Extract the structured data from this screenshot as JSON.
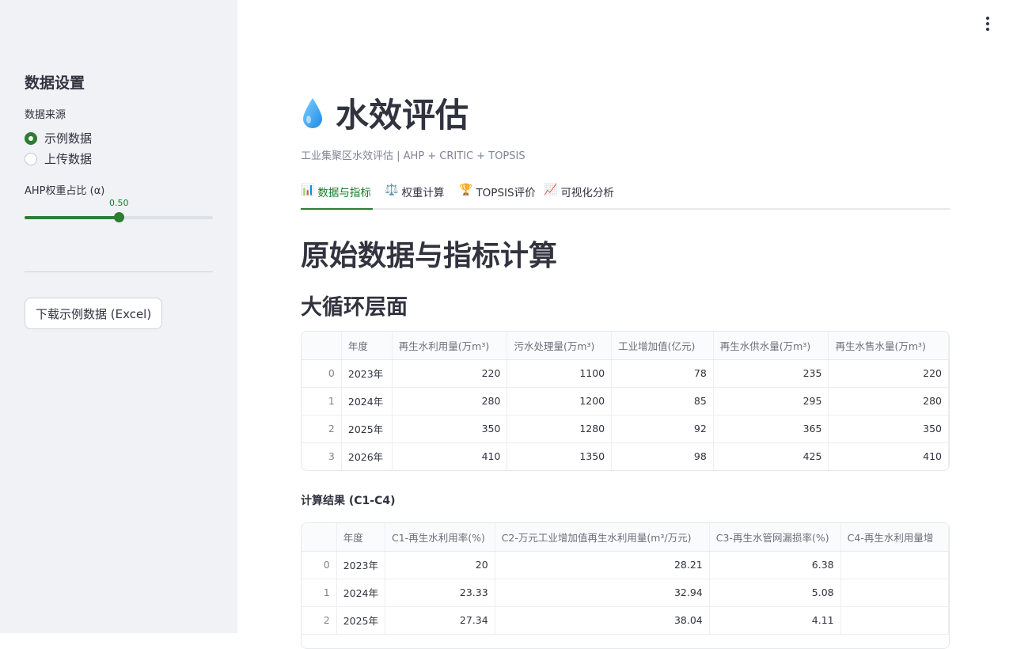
{
  "sidebar": {
    "title": "数据设置",
    "source_label": "数据来源",
    "source_options": [
      "示例数据",
      "上传数据"
    ],
    "selected_source": "示例数据",
    "weight_label": "AHP权重占比 (α)",
    "weight_value": "0.50",
    "weight_fraction": 0.5,
    "download_button": "下载示例数据 (Excel)"
  },
  "header": {
    "title": "水效评估",
    "icon": "droplet-icon",
    "caption": "工业集聚区水效评估 | AHP + CRITIC + TOPSIS"
  },
  "tabs": [
    {
      "icon": "📊",
      "label": "数据与指标",
      "active": true
    },
    {
      "icon": "⚖️",
      "label": "权重计算",
      "active": false
    },
    {
      "icon": "🏆",
      "label": "TOPSIS评价",
      "active": false
    },
    {
      "icon": "📈",
      "label": "可视化分析",
      "active": false
    }
  ],
  "section_title": "原始数据与指标计算",
  "subsection_title": "大循环层面",
  "table1": {
    "columns": [
      "",
      "年度",
      "再生水利用量(万m³)",
      "污水处理量(万m³)",
      "工业增加值(亿元)",
      "再生水供水量(万m³)",
      "再生水售水量(万m³)"
    ],
    "rows": [
      [
        "0",
        "2023年",
        "220",
        "1100",
        "78",
        "235",
        "220"
      ],
      [
        "1",
        "2024年",
        "280",
        "1200",
        "85",
        "295",
        "280"
      ],
      [
        "2",
        "2025年",
        "350",
        "1280",
        "92",
        "365",
        "350"
      ],
      [
        "3",
        "2026年",
        "410",
        "1350",
        "98",
        "425",
        "410"
      ]
    ]
  },
  "results_title": "计算结果 (C1-C4)",
  "table2": {
    "columns": [
      "",
      "年度",
      "C1-再生水利用率(%)",
      "C2-万元工业增加值再生水利用量(m³/万元)",
      "C3-再生水管网漏损率(%)",
      "C4-再生水利用量增"
    ],
    "rows": [
      [
        "0",
        "2023年",
        "20",
        "28.21",
        "6.38",
        ""
      ],
      [
        "1",
        "2024年",
        "23.33",
        "32.94",
        "5.08",
        ""
      ],
      [
        "2",
        "2025年",
        "27.34",
        "38.04",
        "4.11",
        ""
      ]
    ]
  }
}
